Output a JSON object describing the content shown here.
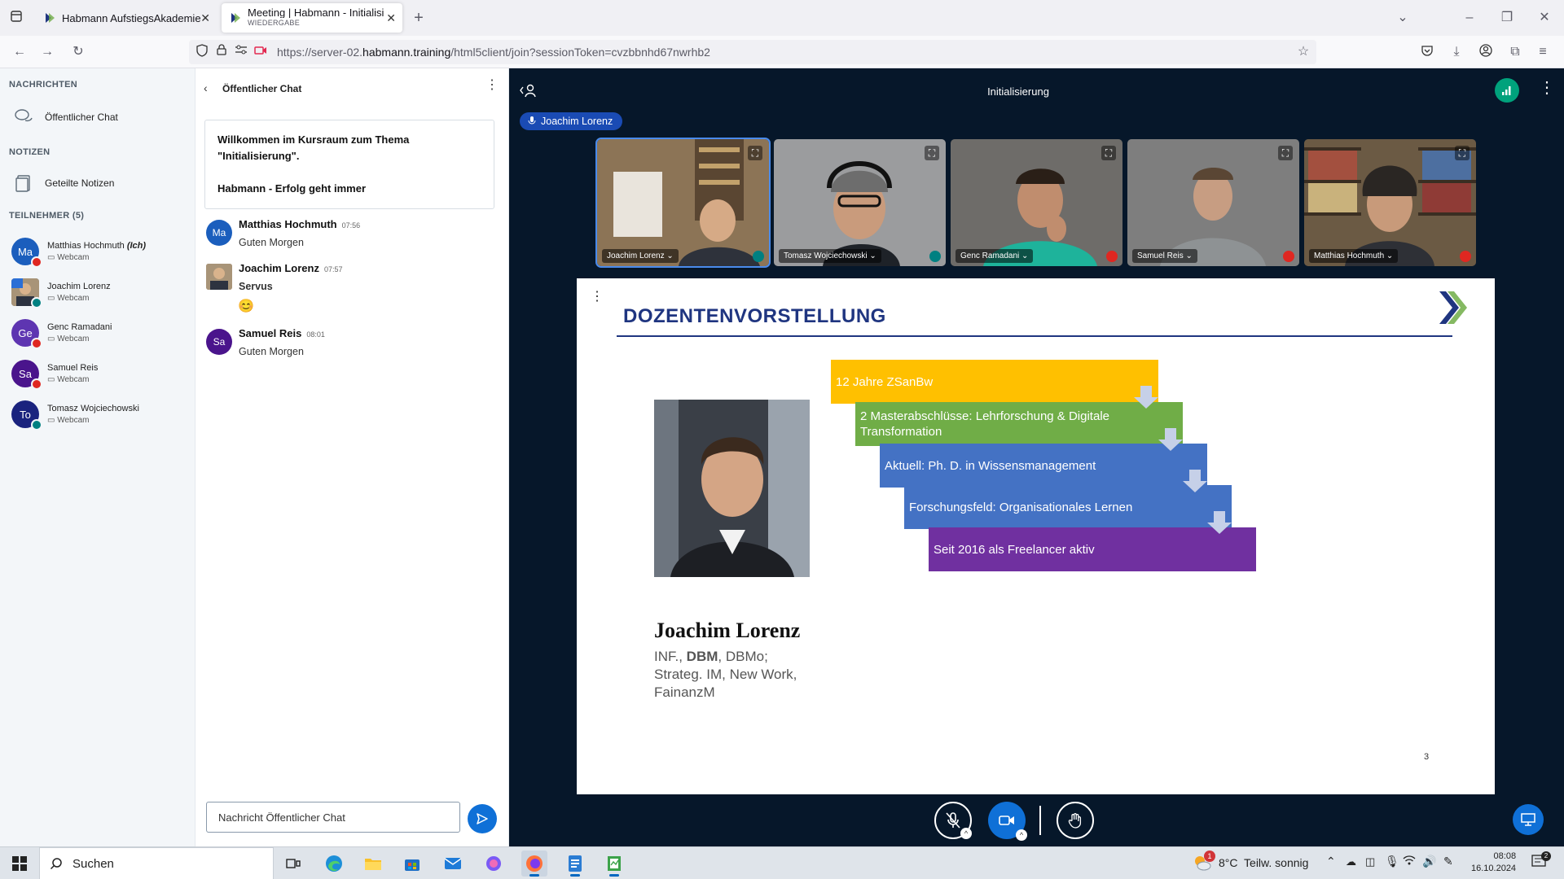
{
  "browser": {
    "tabs": [
      {
        "title": "Habmann AufstiegsAkademie",
        "subtitle": ""
      },
      {
        "title": "Meeting | Habmann - Initialisie",
        "subtitle": "WIEDERGABE"
      }
    ],
    "url_prefix": "https://server-02.",
    "url_host": "habmann.training",
    "url_rest": "/html5client/join?sessionToken=cvzbbnhd67nwrhb2"
  },
  "sidebar": {
    "messages_heading": "NACHRICHTEN",
    "public_chat_label": "Öffentlicher Chat",
    "notes_heading": "NOTIZEN",
    "shared_notes_label": "Geteilte Notizen",
    "participants_heading": "TEILNEHMER (5)",
    "users": [
      {
        "initials": "Ma",
        "name": "Matthias Hochmuth",
        "me": "(Ich)",
        "meta": "Webcam",
        "color": "#1b5ebd",
        "mic": "off"
      },
      {
        "initials": "",
        "name": "Joachim Lorenz",
        "me": "",
        "meta": "Webcam",
        "color": "#6b7a88",
        "mic": "on"
      },
      {
        "initials": "Ge",
        "name": "Genc Ramadani",
        "me": "",
        "meta": "Webcam",
        "color": "#5e35b1",
        "mic": "off"
      },
      {
        "initials": "Sa",
        "name": "Samuel Reis",
        "me": "",
        "meta": "Webcam",
        "color": "#4a148c",
        "mic": "off"
      },
      {
        "initials": "To",
        "name": "Tomasz Wojciechowski",
        "me": "",
        "meta": "Webcam",
        "color": "#1a237e",
        "mic": "on"
      }
    ]
  },
  "chat": {
    "title": "Öffentlicher Chat",
    "welcome_line1": "Willkommen im Kursraum zum Thema",
    "welcome_line2": "\"Initialisierung\".",
    "welcome_line3": "Habmann - Erfolg geht immer",
    "messages": [
      {
        "initials": "Ma",
        "name": "Matthias Hochmuth",
        "time": "07:56",
        "text": "Guten Morgen",
        "color": "#1b5ebd"
      },
      {
        "initials": "",
        "name": "Joachim Lorenz",
        "time": "07:57",
        "text": "Servus",
        "extra": "😊",
        "color": "#6b7a88"
      },
      {
        "initials": "Sa",
        "name": "Samuel Reis",
        "time": "08:01",
        "text": "Guten Morgen",
        "color": "#4a148c"
      }
    ],
    "input_placeholder": "Nachricht Öffentlicher Chat"
  },
  "meeting": {
    "title": "Initialisierung",
    "talking_indicator": "Joachim Lorenz",
    "cameras": [
      {
        "name": "Joachim Lorenz",
        "mic": "on",
        "speaking": true
      },
      {
        "name": "Tomasz Wojciechowski",
        "mic": "on",
        "speaking": false
      },
      {
        "name": "Genc Ramadani",
        "mic": "off",
        "speaking": false
      },
      {
        "name": "Samuel Reis",
        "mic": "off",
        "speaking": false
      },
      {
        "name": "Matthias Hochmuth",
        "mic": "off",
        "speaking": false
      }
    ]
  },
  "slide": {
    "title": "DOZENTENVORSTELLUNG",
    "presenter_name": "Joachim Lorenz",
    "presenter_titles_1": "INF., ",
    "presenter_titles_bold": "DBM",
    "presenter_titles_2": ", DBMo;",
    "presenter_titles_3": "Strateg. IM, New Work,",
    "presenter_titles_4": "FainanzM",
    "steps": [
      {
        "text": "12 Jahre ZSanBw",
        "color": "#ffc000"
      },
      {
        "text": "2 Masterabschlüsse: Lehrforschung & Digitale Transformation",
        "color": "#70ad47"
      },
      {
        "text": "Aktuell: Ph. D. in Wissensmanagement",
        "color": "#4472c4"
      },
      {
        "text": "Forschungsfeld: Organisationales Lernen",
        "color": "#4472c4"
      },
      {
        "text": "Seit 2016 als Freelancer aktiv",
        "color": "#7030a0"
      }
    ],
    "page_number": "3"
  },
  "taskbar": {
    "search_label": "Suchen",
    "weather_temp": "8°C",
    "weather_text": "Teilw. sonnig",
    "weather_badge": "1",
    "time": "08:08",
    "date": "16.10.2024",
    "notification_count": "2"
  }
}
